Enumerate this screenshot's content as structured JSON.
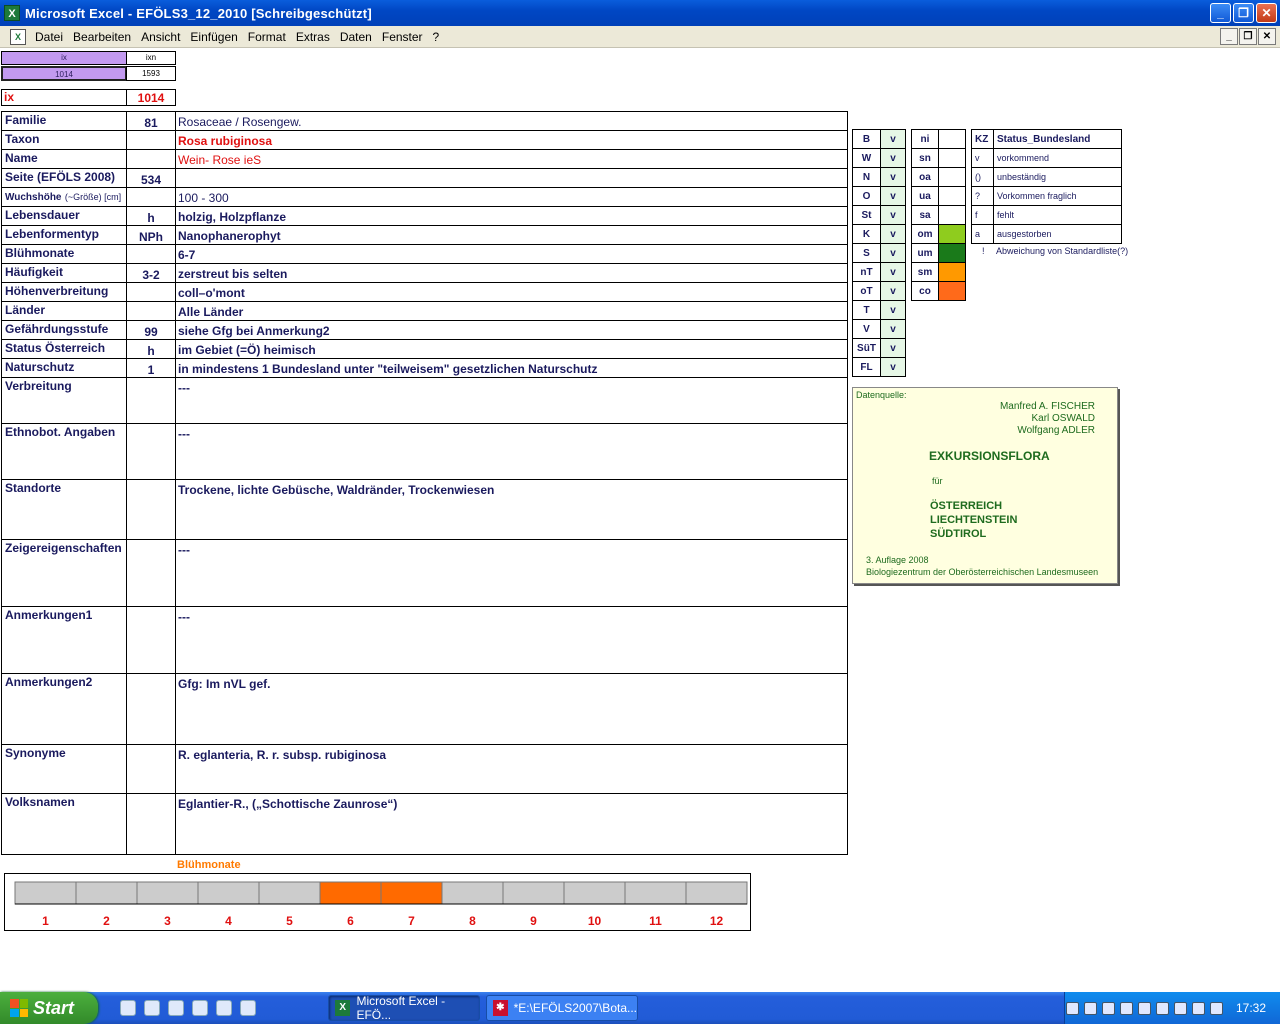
{
  "window": {
    "title": "Microsoft Excel - EFÖLS3_12_2010  [Schreibgeschützt]",
    "app_icon": "X"
  },
  "menu": [
    "Datei",
    "Bearbeiten",
    "Ansicht",
    "Einfügen",
    "Format",
    "Extras",
    "Daten",
    "Fenster",
    "?"
  ],
  "top": {
    "ix_header": "ix",
    "ixn_header": "ixn",
    "ix_value": "1014",
    "ixn_value": "1593",
    "ix_label": "ix",
    "ix_big": "1014"
  },
  "fields": [
    {
      "label": "Familie",
      "code": "81",
      "value": "Rosaceae  /  Rosengew."
    },
    {
      "label": "Taxon",
      "code": "",
      "value": "Rosa rubiginosa"
    },
    {
      "label": "Name",
      "code": "",
      "value": "Wein- Rose ieS"
    },
    {
      "label": "Seite (EFÖLS 2008)",
      "code": "534",
      "value": ""
    },
    {
      "label": "Wuchshöhe",
      "label_small": "(~Größe) [cm]",
      "code": "",
      "value": " 100 - 300"
    },
    {
      "label": "Lebensdauer",
      "code": "h",
      "value": "holzig, Holzpflanze"
    },
    {
      "label": "Lebenformentyp",
      "code": "NPh",
      "value": "Nanophanerophyt"
    },
    {
      "label": "Blühmonate",
      "code": "",
      "value": " 6-7"
    },
    {
      "label": "Häufigkeit",
      "code": "3-2",
      "value": "zerstreut bis selten"
    },
    {
      "label": "Höhenverbreitung",
      "code": "",
      "value": "coll–o'mont"
    },
    {
      "label": "Länder",
      "code": "",
      "value": "Alle Länder"
    },
    {
      "label": "Gefährdungsstufe",
      "code": "99",
      "value": "siehe Gfg bei Anmerkung2"
    },
    {
      "label": "Status Österreich",
      "code": "h",
      "value": "im Gebiet (=Ö) heimisch"
    },
    {
      "label": "Naturschutz",
      "code": "1",
      "value": "in mindestens 1 Bundesland unter \"teilweisem\" gesetzlichen Naturschutz"
    }
  ],
  "blocks": [
    {
      "label": "Verbreitung",
      "value": " ---"
    },
    {
      "label": "Ethnobot. Angaben",
      "value": "---"
    },
    {
      "label": "Standorte",
      "value": "Trockene, lichte Gebüsche, Waldränder, Trockenwiesen"
    },
    {
      "label": "Zeigereigenschaften",
      "value": "---"
    },
    {
      "label": "Anmerkungen1",
      "value": "---"
    },
    {
      "label": "Anmerkungen2",
      "value": "Gfg: Im nVL gef."
    },
    {
      "label": "Synonyme",
      "value": "R. eglanteria, R. r. subsp. rubiginosa"
    },
    {
      "label": "Volksnamen",
      "value": "Eglantier-R., („Schottische Zaunrose“)"
    }
  ],
  "regions": [
    {
      "code": "B",
      "status": "v"
    },
    {
      "code": "W",
      "status": "v"
    },
    {
      "code": "N",
      "status": "v"
    },
    {
      "code": "O",
      "status": "v"
    },
    {
      "code": "St",
      "status": "v"
    },
    {
      "code": "K",
      "status": "v"
    },
    {
      "code": "S",
      "status": "v"
    },
    {
      "code": "nT",
      "status": "v"
    },
    {
      "code": "oT",
      "status": "v"
    },
    {
      "code": "T",
      "status": "v"
    },
    {
      "code": "V",
      "status": "v"
    },
    {
      "code": "SüT",
      "status": "v"
    },
    {
      "code": "FL",
      "status": "v"
    }
  ],
  "altitude": [
    {
      "code": "ni",
      "color": "#ffffff"
    },
    {
      "code": "sn",
      "color": "#ffffff"
    },
    {
      "code": "oa",
      "color": "#ffffff"
    },
    {
      "code": "ua",
      "color": "#ffffff"
    },
    {
      "code": "sa",
      "color": "#ffffff"
    },
    {
      "code": "om",
      "color": "#8fcc1e"
    },
    {
      "code": "um",
      "color": "#1a7a1a"
    },
    {
      "code": "sm",
      "color": "#ff9900"
    },
    {
      "code": "co",
      "color": "#ff6a1a"
    }
  ],
  "legend": {
    "header_kz": "KZ",
    "header_title": "Status_Bundesland",
    "rows": [
      {
        "kz": "v",
        "text": "vorkommend"
      },
      {
        "kz": "()",
        "text": "unbeständig"
      },
      {
        "kz": "?",
        "text": "Vorkommen fraglich"
      },
      {
        "kz": "f",
        "text": "fehlt"
      },
      {
        "kz": "a",
        "text": "ausgestorben"
      },
      {
        "kz": "!",
        "text": "Abweichung von Standardliste(?)"
      }
    ]
  },
  "info": {
    "heading": "Datenquelle:",
    "authors": [
      "Manfred A. FISCHER",
      "Karl OSWALD",
      "Wolfgang ADLER"
    ],
    "book": "EXKURSIONSFLORA",
    "fuer": "für",
    "countries": [
      "ÖSTERREICH",
      "LIECHTENSTEIN",
      "SÜDTIROL"
    ],
    "edition": "3. Auflage 2008",
    "publisher": "Biologiezentrum der Oberösterreichischen Landesmuseen"
  },
  "chart_data": {
    "type": "bar",
    "title": "Blühmonate",
    "categories": [
      "1",
      "2",
      "3",
      "4",
      "5",
      "6",
      "7",
      "8",
      "9",
      "10",
      "11",
      "12"
    ],
    "values": [
      0,
      0,
      0,
      0,
      0,
      1,
      1,
      0,
      0,
      0,
      0,
      0
    ],
    "colors": {
      "active": "#ff6a00",
      "inactive": "#cccccc"
    }
  },
  "taskbar": {
    "start": "Start",
    "tasks": [
      {
        "label": "Microsoft Excel - EFÖ...",
        "active": true
      },
      {
        "label": "*E:\\EFÖLS2007\\Bota...",
        "active": false
      }
    ],
    "clock": "17:32"
  }
}
